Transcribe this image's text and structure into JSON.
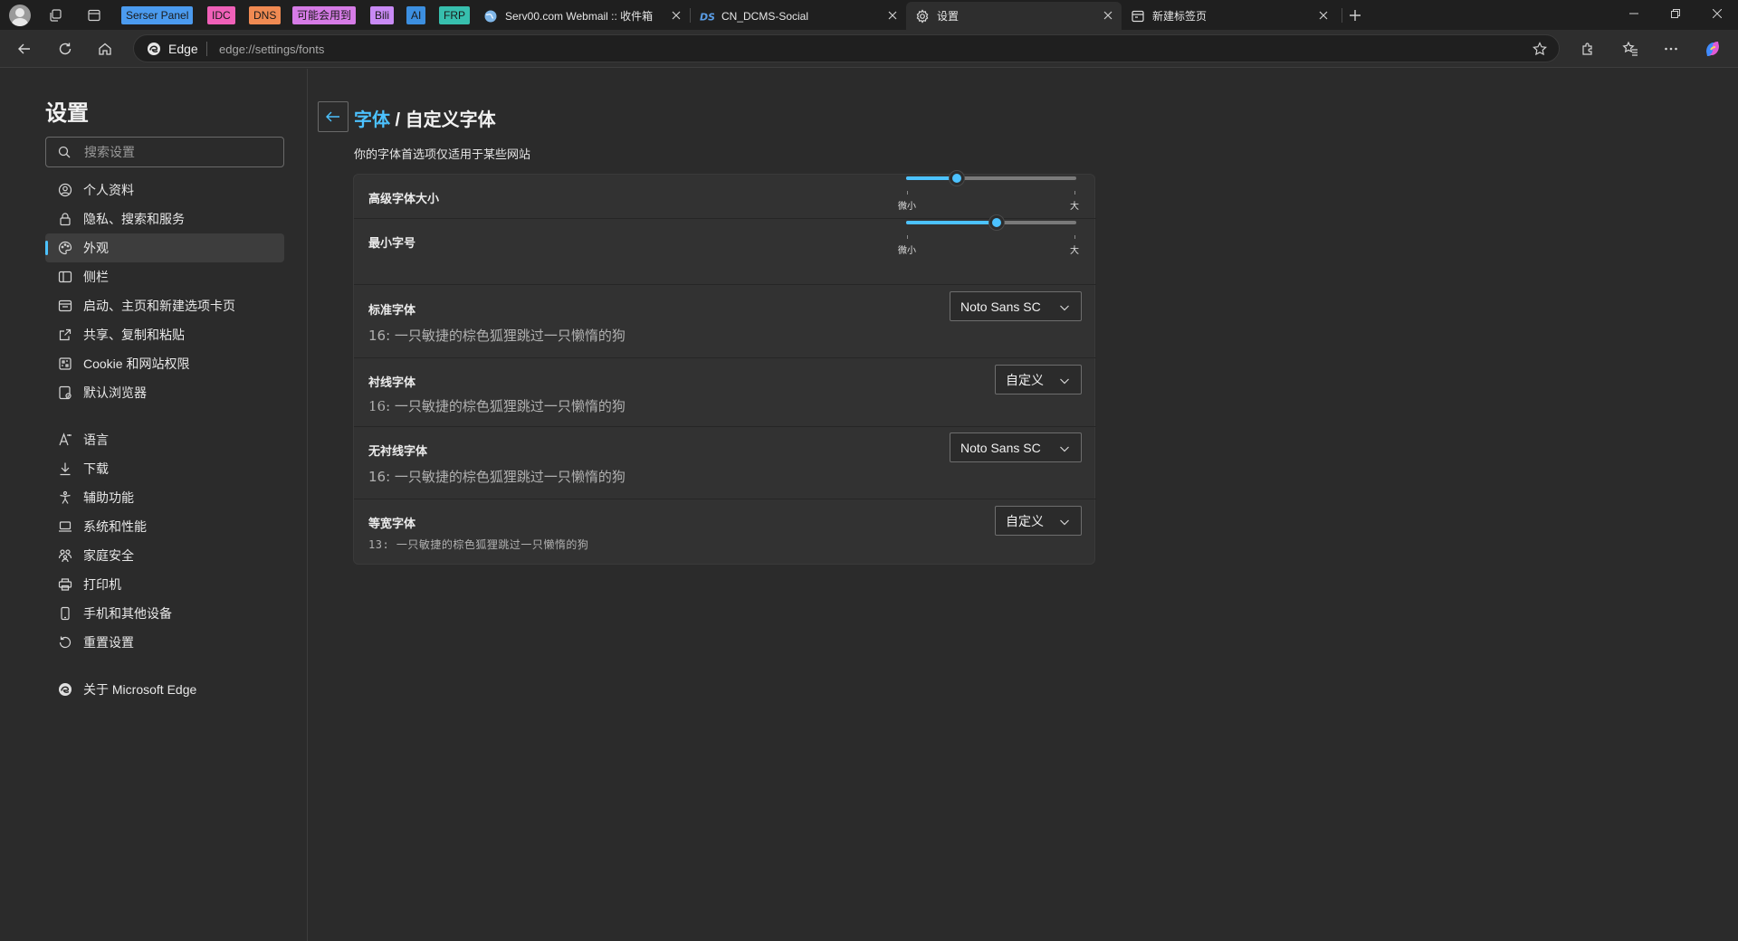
{
  "browser": {
    "bookmarks": [
      {
        "label": "Serser Panel",
        "color": "#4b9bef"
      },
      {
        "label": "IDC",
        "color": "#f060b8"
      },
      {
        "label": "DNS",
        "color": "#f08a52"
      },
      {
        "label": "可能会用到",
        "color": "#d67be6"
      },
      {
        "label": "Bili",
        "color": "#c98af5"
      },
      {
        "label": "AI",
        "color": "#3c8fe0"
      },
      {
        "label": "FRP",
        "color": "#37bfae"
      }
    ],
    "tabs": [
      {
        "title": "Serv00.com Webmail :: 收件箱",
        "icon": "globe-icon"
      },
      {
        "title": "CN_DCMS-Social",
        "icon": "ds-logo-icon"
      },
      {
        "title": "设置",
        "icon": "gear-icon"
      },
      {
        "title": "新建标签页",
        "icon": "newtab-icon"
      }
    ],
    "active_tab": 2,
    "address": {
      "site": "Edge",
      "url": "edge://settings/fonts"
    }
  },
  "sidebar": {
    "title": "设置",
    "search_placeholder": "搜索设置",
    "items": [
      {
        "label": "个人资料",
        "icon": "profile-icon"
      },
      {
        "label": "隐私、搜索和服务",
        "icon": "lock-icon"
      },
      {
        "label": "外观",
        "icon": "palette-icon"
      },
      {
        "label": "侧栏",
        "icon": "sidebar-icon"
      },
      {
        "label": "启动、主页和新建选项卡页",
        "icon": "home-icon"
      },
      {
        "label": "共享、复制和粘贴",
        "icon": "share-icon"
      },
      {
        "label": "Cookie 和网站权限",
        "icon": "cookie-icon"
      },
      {
        "label": "默认浏览器",
        "icon": "browser-icon"
      },
      {
        "label": "语言",
        "icon": "language-icon"
      },
      {
        "label": "下载",
        "icon": "download-icon"
      },
      {
        "label": "辅助功能",
        "icon": "accessibility-icon"
      },
      {
        "label": "系统和性能",
        "icon": "laptop-icon"
      },
      {
        "label": "家庭安全",
        "icon": "family-icon"
      },
      {
        "label": "打印机",
        "icon": "printer-icon"
      },
      {
        "label": "手机和其他设备",
        "icon": "phone-icon"
      },
      {
        "label": "重置设置",
        "icon": "reset-icon"
      },
      {
        "label": "关于 Microsoft Edge",
        "icon": "edge-logo-icon"
      }
    ],
    "selected_index": 2
  },
  "page": {
    "breadcrumb_parent": "字体",
    "breadcrumb_sep": " / ",
    "breadcrumb_current": "自定义字体",
    "subtitle": "你的字体首选项仅适用于某些网站",
    "font_size": {
      "label": "高级字体大小",
      "min_label": "微小",
      "max_label": "大",
      "value": 0.3
    },
    "min_size": {
      "label": "最小字号",
      "min_label": "微小",
      "max_label": "大",
      "value": 0.53
    },
    "fonts": [
      {
        "label": "标准字体",
        "selected": "Noto Sans SC",
        "sample": "16: 一只敏捷的棕色狐狸跳过一只懒惰的狗"
      },
      {
        "label": "衬线字体",
        "selected": "自定义",
        "sample": "16: 一只敏捷的棕色狐狸跳过一只懒惰的狗"
      },
      {
        "label": "无衬线字体",
        "selected": "Noto Sans SC",
        "sample": "16: 一只敏捷的棕色狐狸跳过一只懒惰的狗"
      },
      {
        "label": "等宽字体",
        "selected": "自定义",
        "sample": "13: 一只敏捷的棕色狐狸跳过一只懒惰的狗"
      }
    ]
  }
}
